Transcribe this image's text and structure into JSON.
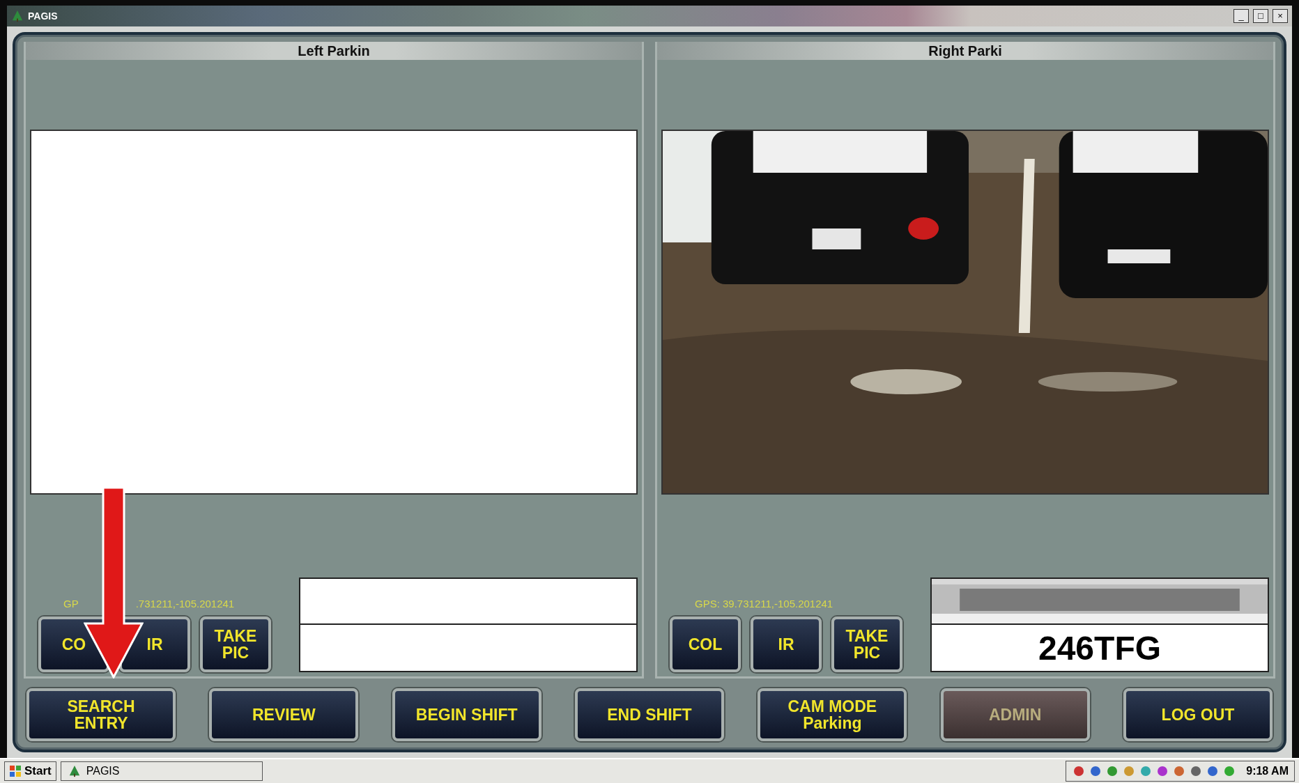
{
  "window": {
    "title": "PAGIS",
    "controls": [
      "_",
      "□",
      "×"
    ]
  },
  "panels": [
    {
      "title": "Left Parkin",
      "view": {
        "kind": "blank"
      },
      "gps_segments": [
        "GP",
        ".731211,-105.201241"
      ],
      "buttons": [
        {
          "label": "CO"
        },
        {
          "label": "IR"
        },
        {
          "label": "TAKE PIC"
        }
      ],
      "plate": {
        "kind": "blank"
      }
    },
    {
      "title": "Right Parki",
      "view": {
        "kind": "picture"
      },
      "gps_segments": [
        "GPS: 39.731211,-105.201241"
      ],
      "buttons": [
        {
          "label": "COL"
        },
        {
          "label": "IR"
        },
        {
          "label": "TAKE PIC"
        }
      ],
      "plate": {
        "kind": "picture",
        "reading": "246TFG"
      }
    }
  ],
  "actions": [
    {
      "label": "SEARCH ENTRY",
      "disabled": false
    },
    {
      "label": "REVIEW",
      "disabled": false
    },
    {
      "label": "BEGIN SHIFT",
      "disabled": false
    },
    {
      "label": "END SHIFT",
      "disabled": false
    },
    {
      "label": "CAM MODE",
      "sub": "Parking",
      "disabled": false
    },
    {
      "label": "ADMIN",
      "disabled": true
    },
    {
      "label": "LOG OUT",
      "disabled": false
    }
  ],
  "taskbar": {
    "start": "Start",
    "task": "PAGIS",
    "clock": "9:18 AM"
  }
}
